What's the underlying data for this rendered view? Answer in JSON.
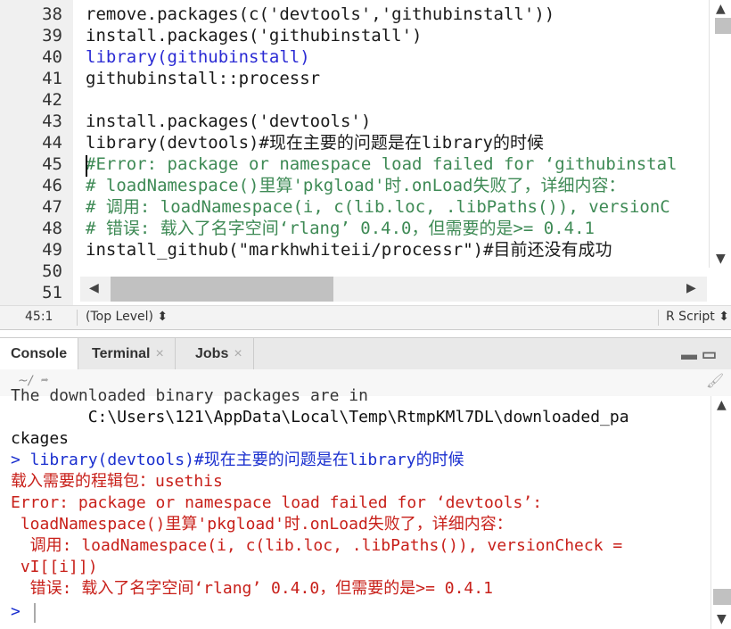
{
  "editor": {
    "line_numbers": [
      "38",
      "39",
      "40",
      "41",
      "42",
      "43",
      "44",
      "45",
      "46",
      "47",
      "48",
      "49",
      "50",
      "51"
    ],
    "lines": [
      "remove.packages(c('devtools','githubinstall'))",
      "install.packages('githubinstall')",
      "library(githubinstall)",
      "githubinstall::processr",
      "",
      "install.packages('devtools')",
      "library(devtools)#现在主要的问题是在library的时候",
      "#Error: package or namespace load failed for ‘githubinstal",
      "# loadNamespace()里算'pkgload'时.onLoad失败了，详细内容：",
      "# 调用: loadNamespace(i, c(lib.loc, .libPaths()), versionC",
      "# 错误: 载入了名字空间‘rlang’ 0.4.0，但需要的是>= 0.4.1",
      "install_github(\"markhwhiteii/processr\")#目前还没有成功",
      "",
      ""
    ]
  },
  "status_bar": {
    "cursor_position": "45:1",
    "scope": "(Top Level) ⬍",
    "file_type": "R Script ⬍"
  },
  "console_tabs": [
    {
      "label": "Console"
    },
    {
      "label": "Terminal"
    },
    {
      "label": "Jobs"
    }
  ],
  "console": {
    "path": "~/",
    "lines": [
      "The downloaded binary packages are in",
      "        C:\\Users\\121\\AppData\\Local\\Temp\\RtmpKMl7DL\\downloaded_pa",
      "ckages",
      "> library(devtools)#现在主要的问题是在library的时候",
      "载入需要的程辑包：usethis",
      "Error: package or namespace load failed for ‘devtools’:",
      " loadNamespace()里算'pkgload'时.onLoad失败了，详细内容：",
      "  调用: loadNamespace(i, c(lib.loc, .libPaths()), versionCheck =",
      " vI[[i]])",
      "  错误: 载入了名字空间‘rlang’ 0.4.0，但需要的是>= 0.4.1",
      ">"
    ]
  },
  "colors": {
    "accent_blue": "#1a2fcf",
    "error_red": "#c8201a",
    "string_green": "#0b7a35"
  }
}
